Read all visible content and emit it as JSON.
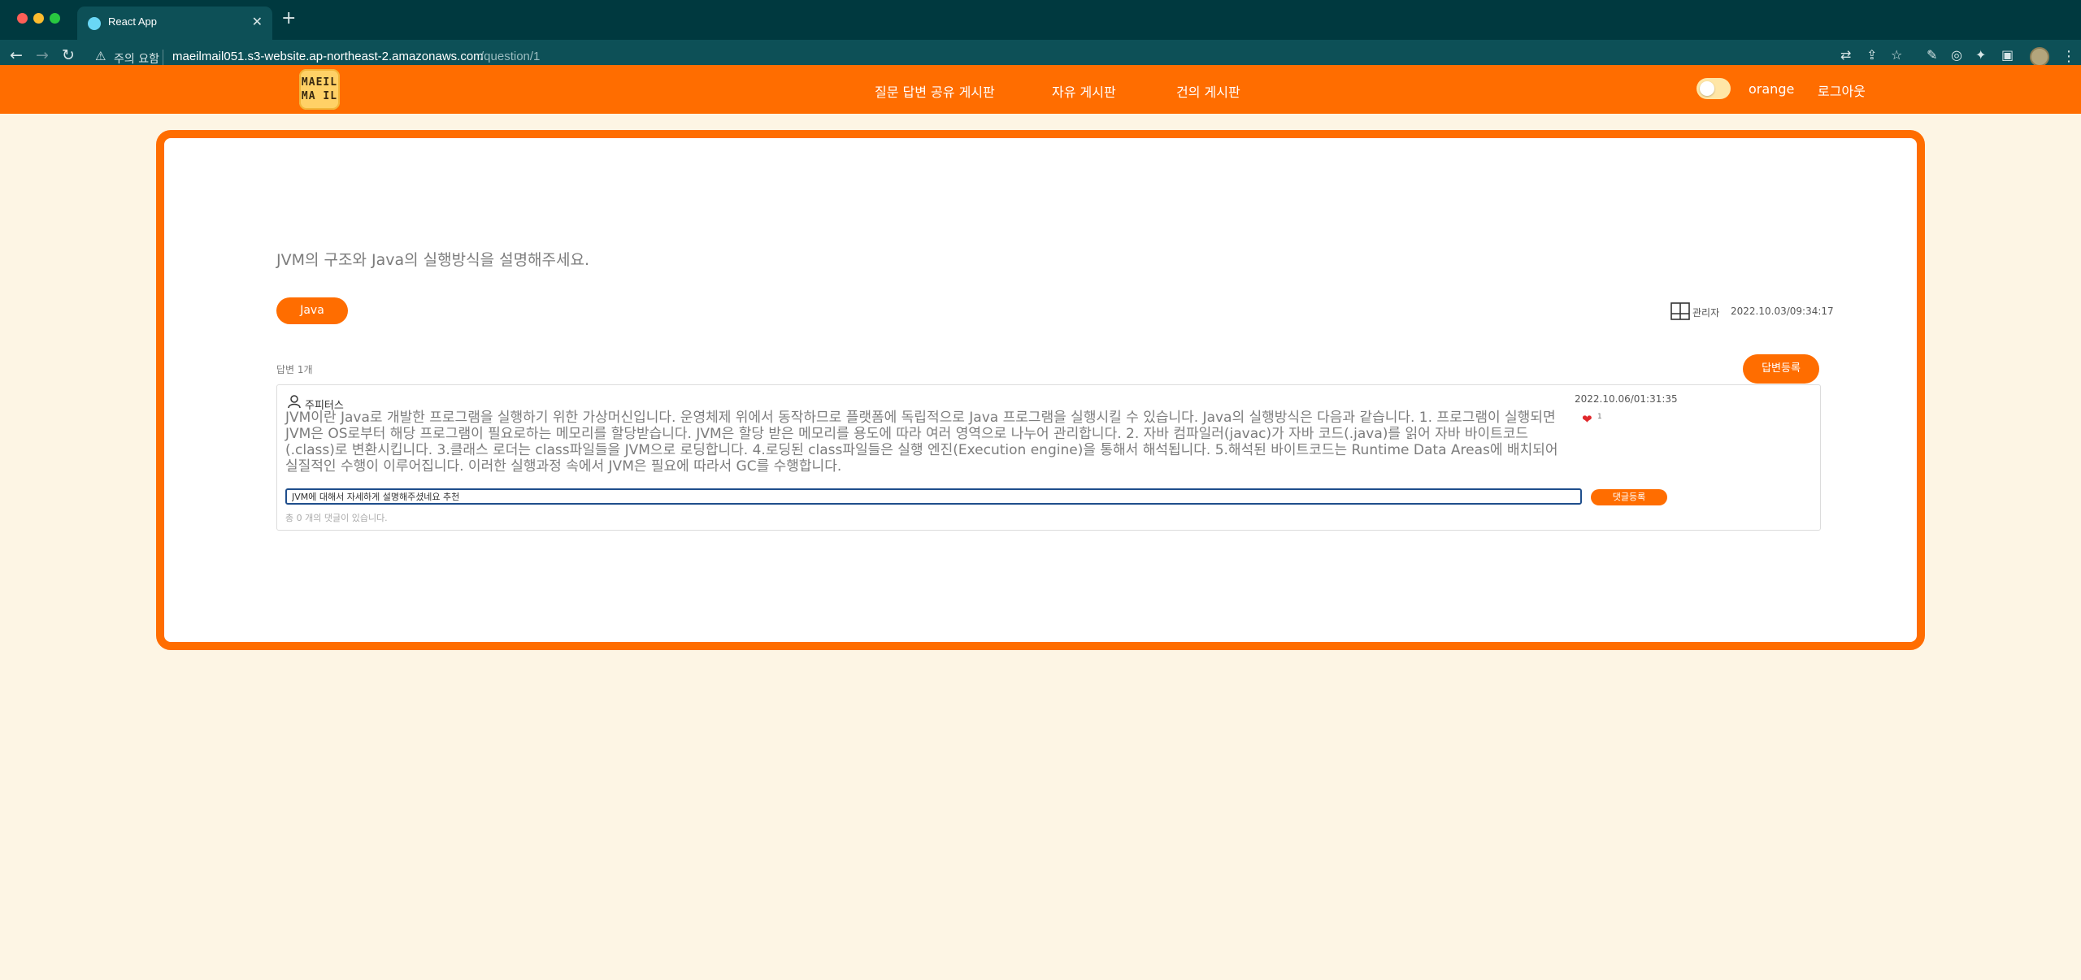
{
  "browser": {
    "tab_title": "React App",
    "security_label": "주의 요함",
    "url_host": "maeilmail051.s3-website.ap-northeast-2.amazonaws.com",
    "url_path": "/question/1"
  },
  "header": {
    "logo_line1": "MAEIL",
    "logo_line2": "MA IL",
    "nav": [
      "질문 답변 공유 게시판",
      "자유 게시판",
      "건의 게시판"
    ],
    "theme_label": "orange",
    "logout_label": "로그아웃"
  },
  "question": {
    "title": "JVM의 구조와 Java의 실행방식을 설명해주세요.",
    "tag": "Java",
    "author": "관리자",
    "date": "2022.10.03/09:34:17",
    "answer_count_label": "답변 1개",
    "answer_button": "답변등록"
  },
  "answer": {
    "author": "주피터스",
    "date": "2022.10.06/01:31:35",
    "body": "JVM이란 Java로 개발한 프로그램을 실행하기 위한 가상머신입니다. 운영체제 위에서 동작하므로 플랫폼에 독립적으로 Java 프로그램을 실행시킬 수 있습니다. Java의 실행방식은 다음과 같습니다. 1. 프로그램이 실행되면 JVM은 OS로부터 해당 프로그램이 필요로하는 메모리를 할당받습니다. JVM은 할당 받은 메모리를 용도에 따라 여러 영역으로 나누어 관리합니다. 2. 자바 컴파일러(javac)가 자바 코드(.java)를 읽어 자바 바이트코드(.class)로 변환시킵니다. 3.클래스 로더는 class파일들을 JVM으로 로딩합니다. 4.로딩된 class파일들은 실행 엔진(Execution engine)을 통해서 해석됩니다. 5.해석된 바이트코드는 Runtime Data Areas에 배치되어 실질적인 수행이 이루어집니다. 이러한 실행과정 속에서 JVM은 필요에 따라서 GC를 수행합니다.",
    "like_count": "1",
    "comment_value": "JVM에 대해서 자세하게 설명해주셨네요 추천",
    "comment_button": "댓글등록",
    "comment_count_label": "총 0 개의 댓글이 있습니다."
  },
  "colors": {
    "accent": "#ff6d00",
    "background": "#fdf5e4",
    "toolbar": "#0d5057"
  }
}
